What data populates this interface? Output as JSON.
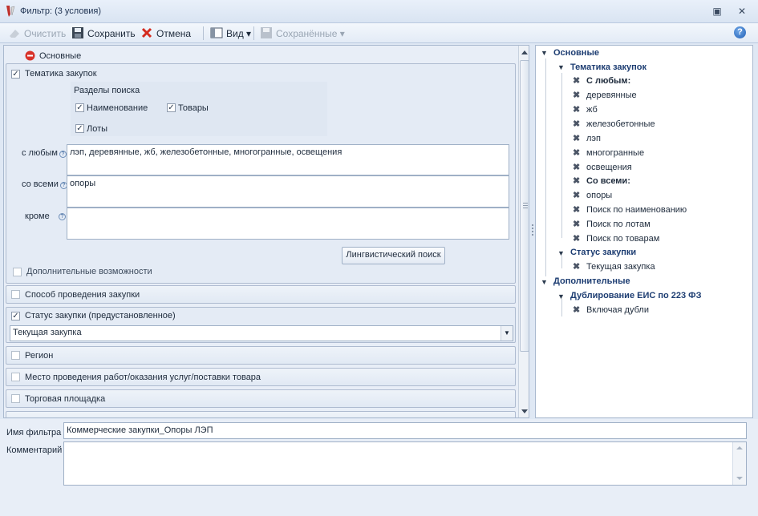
{
  "window": {
    "title": "Фильтр: (3 условия)"
  },
  "toolbar": {
    "clear": "Очистить",
    "save": "Сохранить",
    "cancel": "Отмена",
    "view": "Вид",
    "saved": "Сохранённые"
  },
  "left": {
    "section_main": "Основные",
    "topics": {
      "label": "Тематика закупок",
      "checked": true
    },
    "search_sections": {
      "title": "Разделы поиска",
      "name": "Наименование",
      "goods": "Товары",
      "lots": "Лоты"
    },
    "any_label": "с любым",
    "any_value": "лэп, деревянные, жб, железобетонные, многогранные, освещения",
    "all_label": "со всеми",
    "all_value": "опоры",
    "except_label": "кроме",
    "except_value": "",
    "ling_button": "Лингвистический поиск",
    "extra": "Дополнительные возможности",
    "method": "Способ проведения закупки",
    "status": "Статус закупки (предустановленное)",
    "status_value": "Текущая закупка",
    "region": "Регион",
    "place": "Место проведения работ/оказания услуг/поставки товара",
    "platform": "Торговая площадка"
  },
  "tree": {
    "main": "Основные",
    "topics": "Тематика закупок",
    "any": "С любым:",
    "w1": "деревянные",
    "w2": "жб",
    "w3": "железобетонные",
    "w4": "лэп",
    "w5": "многогранные",
    "w6": "освещения",
    "all": "Со всеми:",
    "a1": "опоры",
    "s1": "Поиск по наименованию",
    "s2": "Поиск по лотам",
    "s3": "Поиск по товарам",
    "status": "Статус закупки",
    "status_val": "Текущая закупка",
    "extra": "Дополнительные",
    "dup": "Дублирование ЕИС по 223 ФЗ",
    "dup_val": "Включая дубли"
  },
  "bottom": {
    "name_label": "Имя фильтра",
    "name_value": "Коммерческие закупки_Опоры ЛЭП",
    "comment_label": "Комментарий",
    "comment_value": ""
  }
}
